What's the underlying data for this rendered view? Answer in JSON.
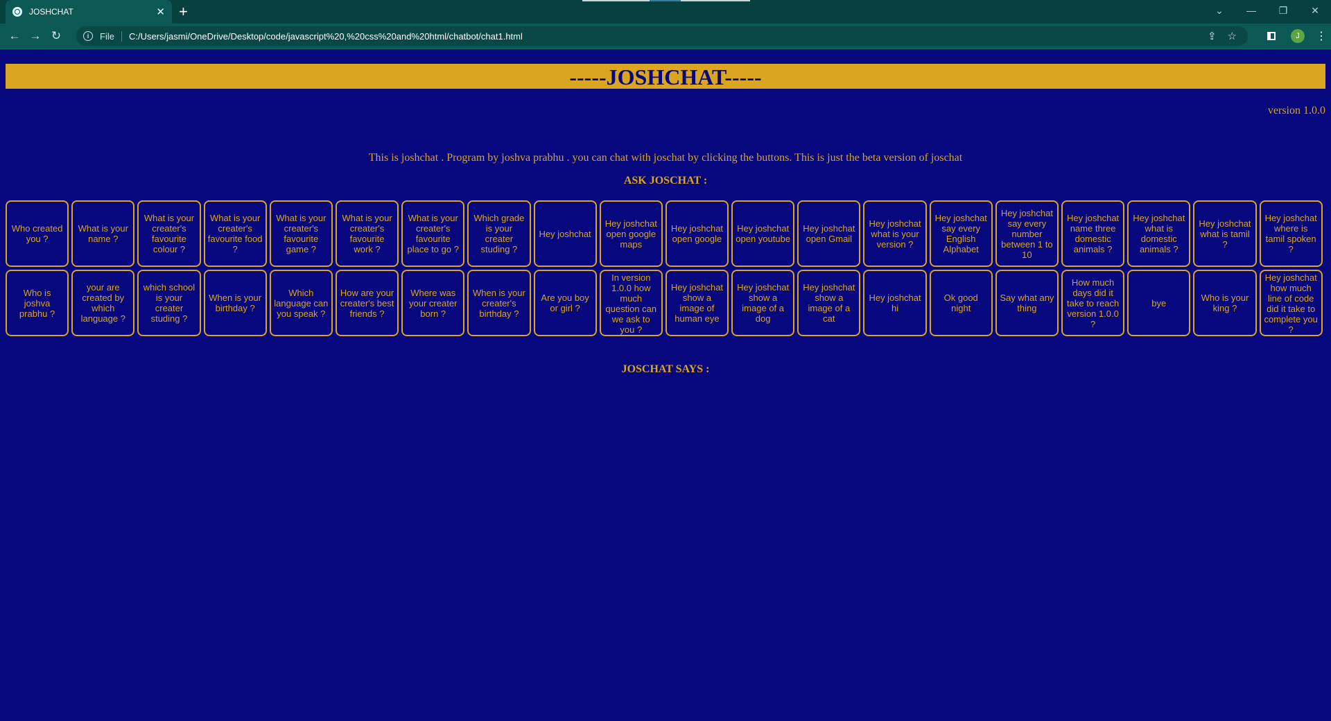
{
  "browser": {
    "tab_title": "JOSHCHAT",
    "tab_close": "✕",
    "new_tab": "+",
    "file_label": "File",
    "url": "C:/Users/jasmi/OneDrive/Desktop/code/javascript%20,%20css%20and%20html/chatbot/chat1.html",
    "avatar_letter": "J",
    "icons": [
      "back-arrow-icon",
      "forward-arrow-icon",
      "reload-icon",
      "info-icon",
      "share-icon",
      "star-icon",
      "side-panel-icon",
      "menu-icon"
    ]
  },
  "page": {
    "title": "-----JOSHCHAT-----",
    "version": "version 1.0.0",
    "intro": "This is joshchat . Program by joshva prabhu . you can chat with joschat by clicking the buttons. This is just the beta version of joschat",
    "ask_title": "ASK JOSCHAT :",
    "says_title": "JOSCHAT SAYS :",
    "colors": {
      "background": "#07077e",
      "accent": "#daa520"
    },
    "buttons": [
      "Who created you ?",
      "What is your name ?",
      "What is your creater's favourite colour ?",
      "What is your creater's favourite food ?",
      "What is your creater's favourite game ?",
      "What is your creater's favourite work ?",
      "What is your creater's favourite place to go ?",
      "Which grade is your creater studing ?",
      "Hey joshchat",
      "Hey joshchat open google maps",
      "Hey joshchat open google",
      "Hey joshchat open youtube",
      "Hey joshchat open Gmail",
      "Hey joshchat what is your version ?",
      "Hey joshchat say every English Alphabet",
      "Hey joshchat say every number between 1 to 10",
      "Hey joshchat name three domestic animals ?",
      "Hey joshchat what is domestic animals ?",
      "Hey joshchat what is tamil ?",
      "Hey joshchat where is tamil spoken ?",
      "Who is joshva prabhu ?",
      "your are created by which language ?",
      "which school is your creater studing ?",
      "When is your birthday ?",
      "Which language can you speak ?",
      "How are your creater's best friends ?",
      "Where was your creater born ?",
      "When is your creater's birthday ?",
      "Are you boy or girl ?",
      "In version 1.0.0 how much question can we ask to you ?",
      "Hey joshchat show a image of human eye",
      "Hey joshchat show a image of a dog",
      "Hey joshchat show a image of a cat",
      "Hey joshchat hi",
      "Ok good night",
      "Say what any thing",
      "How much days did it take to reach version 1.0.0 ?",
      "bye",
      "Who is your king ?",
      "Hey joshchat how much line of code did it take to complete you ?"
    ]
  }
}
